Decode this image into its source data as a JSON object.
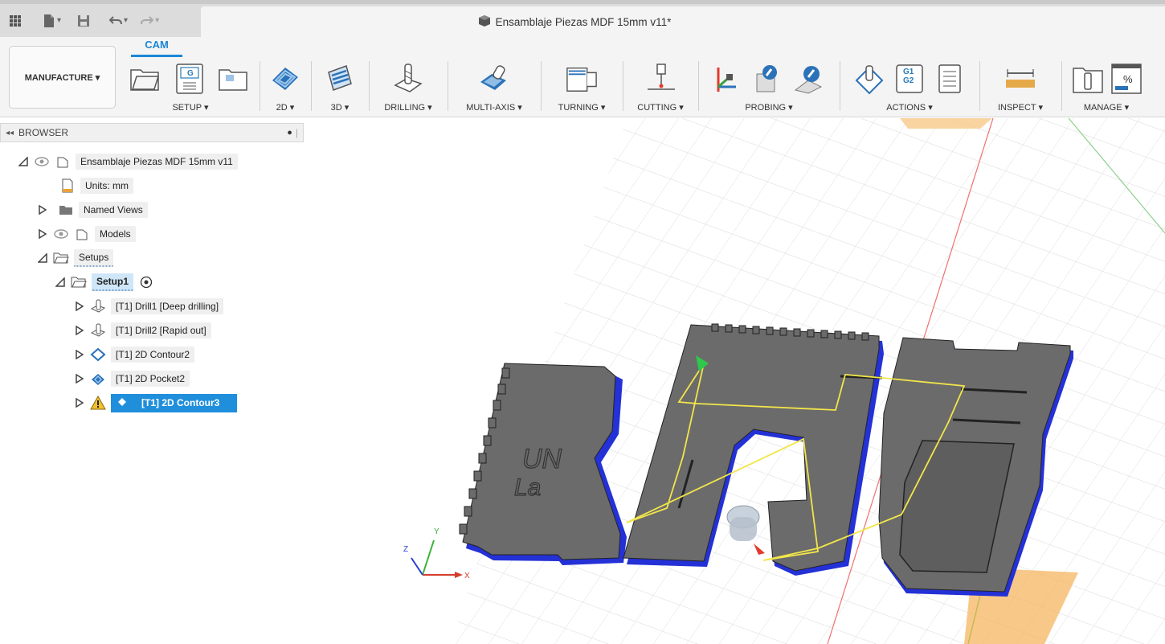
{
  "title": {
    "document": "Ensamblaje Piezas MDF 15mm v11*"
  },
  "ribbon": {
    "tab": "CAM",
    "workspace": "MANUFACTURE ▾",
    "groups": {
      "setup": "SETUP ▾",
      "two_d": "2D ▾",
      "three_d": "3D ▾",
      "drilling": "DRILLING ▾",
      "multi_axis": "MULTI-AXIS ▾",
      "turning": "TURNING ▾",
      "cutting": "CUTTING ▾",
      "probing": "PROBING ▾",
      "actions": "ACTIONS ▾",
      "inspect": "INSPECT ▾",
      "manage": "MANAGE ▾"
    },
    "nc_program_icon_text": "G",
    "g1g2_top": "G1",
    "g1g2_bottom": "G2",
    "percent_icon_text": "%"
  },
  "browser": {
    "header": "BROWSER",
    "root": "Ensamblaje Piezas MDF 15mm v11",
    "units": "Units: mm",
    "named_views": "Named Views",
    "models": "Models",
    "setups": "Setups",
    "setup1": "Setup1",
    "operations": [
      "[T1] Drill1 [Deep drilling]",
      "[T1] Drill2 [Rapid out]",
      "[T1] 2D Contour2",
      "[T1] 2D Pocket2",
      "[T1] 2D Contour3"
    ]
  },
  "viewport": {
    "logo_line1": "UN",
    "logo_line2": "La",
    "axis_x": "X",
    "axis_y": "Y",
    "axis_z": "Z"
  }
}
